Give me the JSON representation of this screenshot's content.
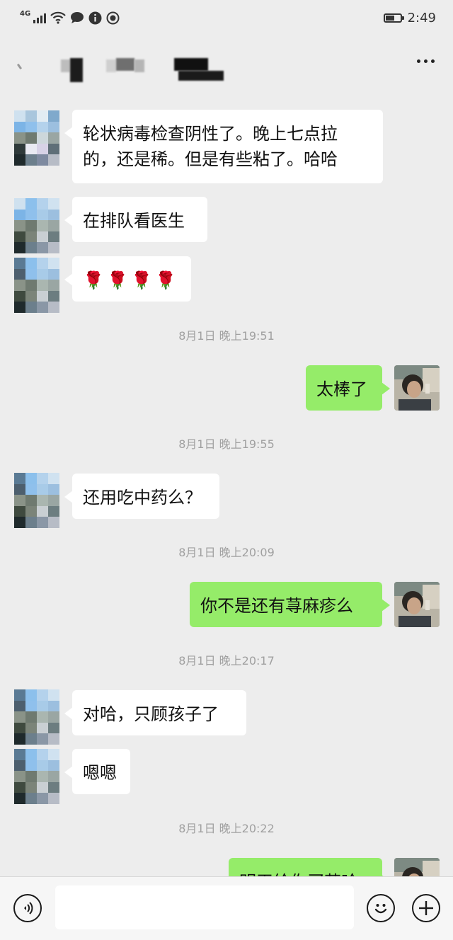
{
  "status_bar": {
    "network_label": "4G",
    "time": "2:49",
    "battery_level": 0.65,
    "icons": [
      "signal-icon",
      "wifi-icon",
      "chat-notification-icon",
      "info-notification-icon",
      "app-notification-icon",
      "battery-icon"
    ]
  },
  "header": {
    "more_icon": "more-dots-icon"
  },
  "messages": [
    {
      "type": "incoming",
      "lines": [
        "轮状病毒检查阴性了。晚上七点拉",
        "的，还是稀。但是有些粘了。哈哈"
      ]
    },
    {
      "type": "incoming",
      "text": "在排队看医生"
    },
    {
      "type": "incoming",
      "content": "roses",
      "roses": [
        "🌹",
        "🌹",
        "🌹",
        "🌹"
      ]
    },
    {
      "type": "timestamp",
      "text": "8月1日 晚上19:51"
    },
    {
      "type": "outgoing",
      "text": "太棒了"
    },
    {
      "type": "timestamp",
      "text": "8月1日 晚上19:55"
    },
    {
      "type": "incoming",
      "text": "还用吃中药么？"
    },
    {
      "type": "timestamp",
      "text": "8月1日 晚上20:09"
    },
    {
      "type": "outgoing",
      "text": "你不是还有荨麻疹么"
    },
    {
      "type": "timestamp",
      "text": "8月1日 晚上20:17"
    },
    {
      "type": "incoming",
      "text": "对哈，只顾孩子了"
    },
    {
      "type": "incoming",
      "text": "嗯嗯"
    },
    {
      "type": "timestamp",
      "text": "8月1日 晚上20:22"
    },
    {
      "type": "outgoing",
      "text": "明天给你买药哈"
    }
  ],
  "input_bar": {
    "input_value": "",
    "icons": [
      "voice-icon",
      "emoji-icon",
      "plus-icon"
    ]
  },
  "colors": {
    "background": "#ededed",
    "incoming_bubble": "#ffffff",
    "outgoing_bubble": "#95ec69",
    "timestamp_text": "#a0a0a0"
  }
}
